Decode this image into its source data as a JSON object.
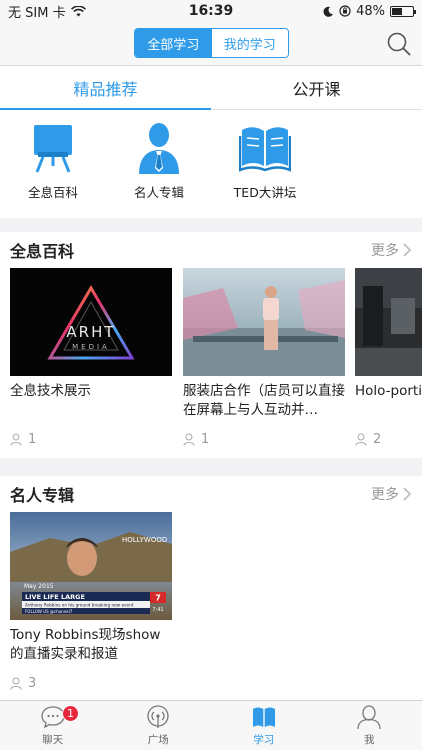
{
  "status_bar": {
    "carrier": "无 SIM 卡",
    "time": "16:39",
    "battery": "48%",
    "battery_level": 0.48
  },
  "nav": {
    "segments": [
      "全部学习",
      "我的学习"
    ],
    "active_segment": 0
  },
  "tabs": [
    "精品推荐",
    "公开课"
  ],
  "categories": [
    {
      "label": "全息百科",
      "icon": "projector-board-icon"
    },
    {
      "label": "名人专辑",
      "icon": "person-tie-icon"
    },
    {
      "label": "TED大讲坛",
      "icon": "open-book-icon"
    }
  ],
  "sections": [
    {
      "title": "全息百科",
      "more": "更多",
      "cards": [
        {
          "title": "全息技术展示",
          "count": "1",
          "thumb": "arht-media-logo"
        },
        {
          "title": "服装店合作（店员可以直接在屏幕上与人互动并…",
          "count": "1",
          "thumb": "store-hologram"
        },
        {
          "title": "Holo-porti",
          "count": "2",
          "thumb": "holoportation-room"
        }
      ]
    },
    {
      "title": "名人专辑",
      "more": "更多",
      "cards": [
        {
          "title": "Tony Robbins现场show的直播实录和报道",
          "count": "3",
          "thumb": "news-broadcast"
        }
      ]
    }
  ],
  "thumb_text": {
    "arht_brand": "ARHT",
    "arht_sub": "MEDIA",
    "tv_sign": "HOLLYWOOD",
    "tv_date": "May 2015",
    "tv_headline": "LIVE LIFE LARGE",
    "tv_sub": "Anthony Robbins on his ground breaking new event",
    "tv_ticker": "FOLLOW US @channel7",
    "tv_channel": "7",
    "tv_time": "7:41"
  },
  "tabbar": [
    {
      "label": "聊天",
      "icon": "chat-bubble-icon",
      "badge": "1"
    },
    {
      "label": "广场",
      "icon": "broadcast-icon"
    },
    {
      "label": "学习",
      "icon": "book-icon",
      "selected": true
    },
    {
      "label": "我",
      "icon": "user-icon"
    }
  ],
  "colors": {
    "accent": "#2f9be8",
    "badge": "#e8283c"
  }
}
